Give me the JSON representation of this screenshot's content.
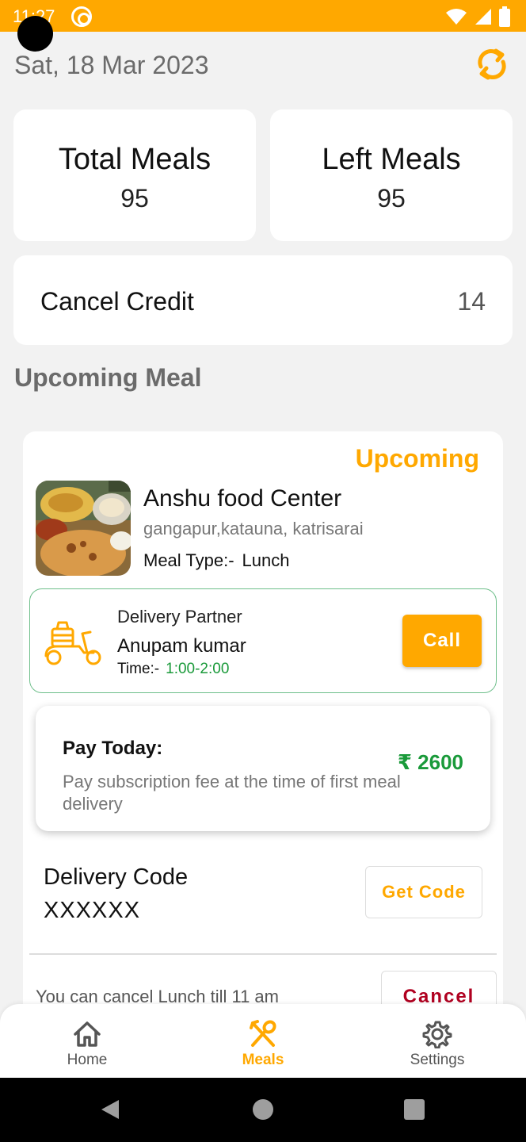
{
  "status_bar": {
    "time": "11:27"
  },
  "header": {
    "date": "Sat, 18 Mar 2023"
  },
  "stats": {
    "total_meals_label": "Total Meals",
    "total_meals_value": "95",
    "left_meals_label": "Left Meals",
    "left_meals_value": "95"
  },
  "credit": {
    "label": "Cancel Credit",
    "value": "14"
  },
  "section": {
    "title": "Upcoming Meal"
  },
  "meal": {
    "status": "Upcoming",
    "restaurant": "Anshu food Center",
    "address": "gangapur,katauna, katrisarai",
    "meal_type_label": "Meal Type:-",
    "meal_type_value": "Lunch"
  },
  "delivery": {
    "partner_label": "Delivery Partner",
    "partner_name": "Anupam kumar",
    "time_label": "Time:-",
    "time_value": "1:00-2:00",
    "call_label": "Call"
  },
  "payment": {
    "title": "Pay Today:",
    "amount": "₹ 2600",
    "description": "Pay subscription fee at the time of first meal delivery"
  },
  "code": {
    "label": "Delivery Code",
    "value": "XXXXXX",
    "button_label": "Get Code"
  },
  "cancel": {
    "note": "You can cancel Lunch till 11 am",
    "button_label": "Cancel"
  },
  "bottom_nav": {
    "items": [
      {
        "label": "Home",
        "icon": "home-icon"
      },
      {
        "label": "Meals",
        "icon": "fork-spoon-icon"
      },
      {
        "label": "Settings",
        "icon": "gear-icon"
      }
    ],
    "active": "Meals"
  },
  "colors": {
    "accent": "#FFA800",
    "success": "#1a9a3a",
    "danger": "#B00020"
  }
}
